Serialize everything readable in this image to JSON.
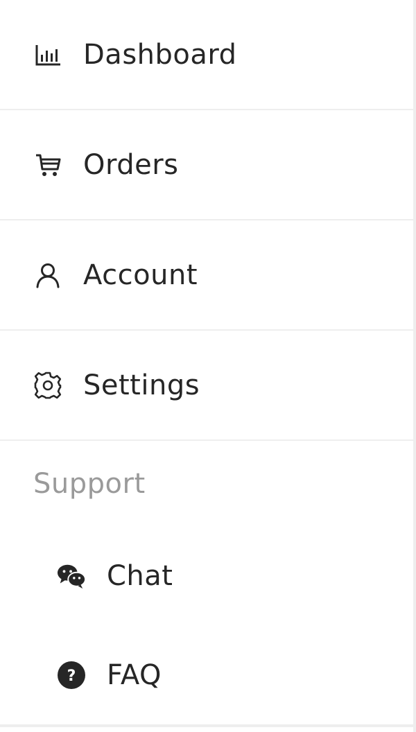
{
  "menu": {
    "items": [
      {
        "label": "Dashboard",
        "icon": "bar-chart-icon"
      },
      {
        "label": "Orders",
        "icon": "cart-icon"
      },
      {
        "label": "Account",
        "icon": "user-icon"
      },
      {
        "label": "Settings",
        "icon": "gear-icon"
      }
    ],
    "support": {
      "title": "Support",
      "items": [
        {
          "label": "Chat",
          "icon": "wechat-icon"
        },
        {
          "label": "FAQ",
          "icon": "question-circle-icon"
        }
      ]
    }
  },
  "colors": {
    "text": "#262626",
    "muted": "#9a9a9a",
    "divider": "#eeeeee"
  }
}
